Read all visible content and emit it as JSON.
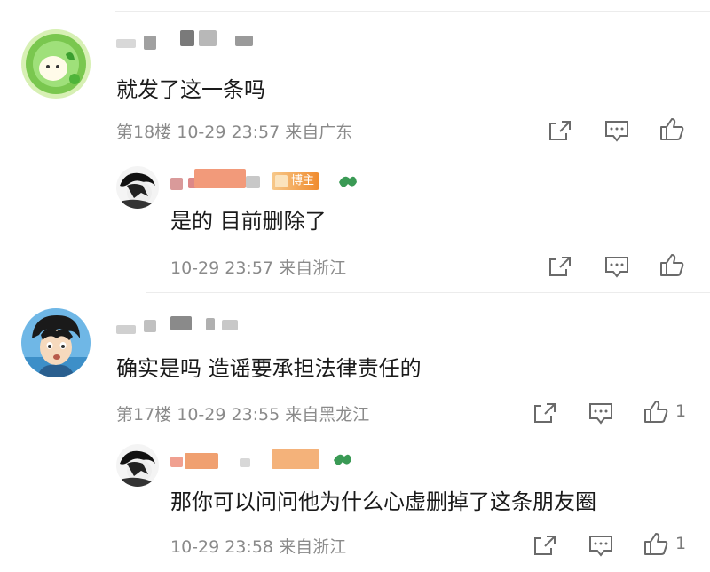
{
  "comments": [
    {
      "content": "就发了这一条吗",
      "floor": "第18楼",
      "time": "10-29 23:57",
      "location": "来自广东",
      "like_count": "",
      "reply": {
        "content": "是的 目前删除了",
        "badge": "博主",
        "time": "10-29 23:57",
        "location": "来自浙江",
        "like_count": ""
      }
    },
    {
      "content": "确实是吗 造谣要承担法律责任的",
      "floor": "第17楼",
      "time": "10-29 23:55",
      "location": "来自黑龙江",
      "like_count": "1",
      "reply": {
        "content": "那你可以问问他为什么心虚删掉了这条朋友圈",
        "time": "10-29 23:58",
        "location": "来自浙江",
        "like_count": "1"
      }
    }
  ],
  "colors": {
    "accent": "#f08a2c",
    "meta": "#8a8a8a",
    "divider": "#ececec",
    "vip_leaf": "#3a9a55"
  },
  "icons": [
    "share-icon",
    "comment-icon",
    "like-icon",
    "vip-leaf-icon"
  ]
}
